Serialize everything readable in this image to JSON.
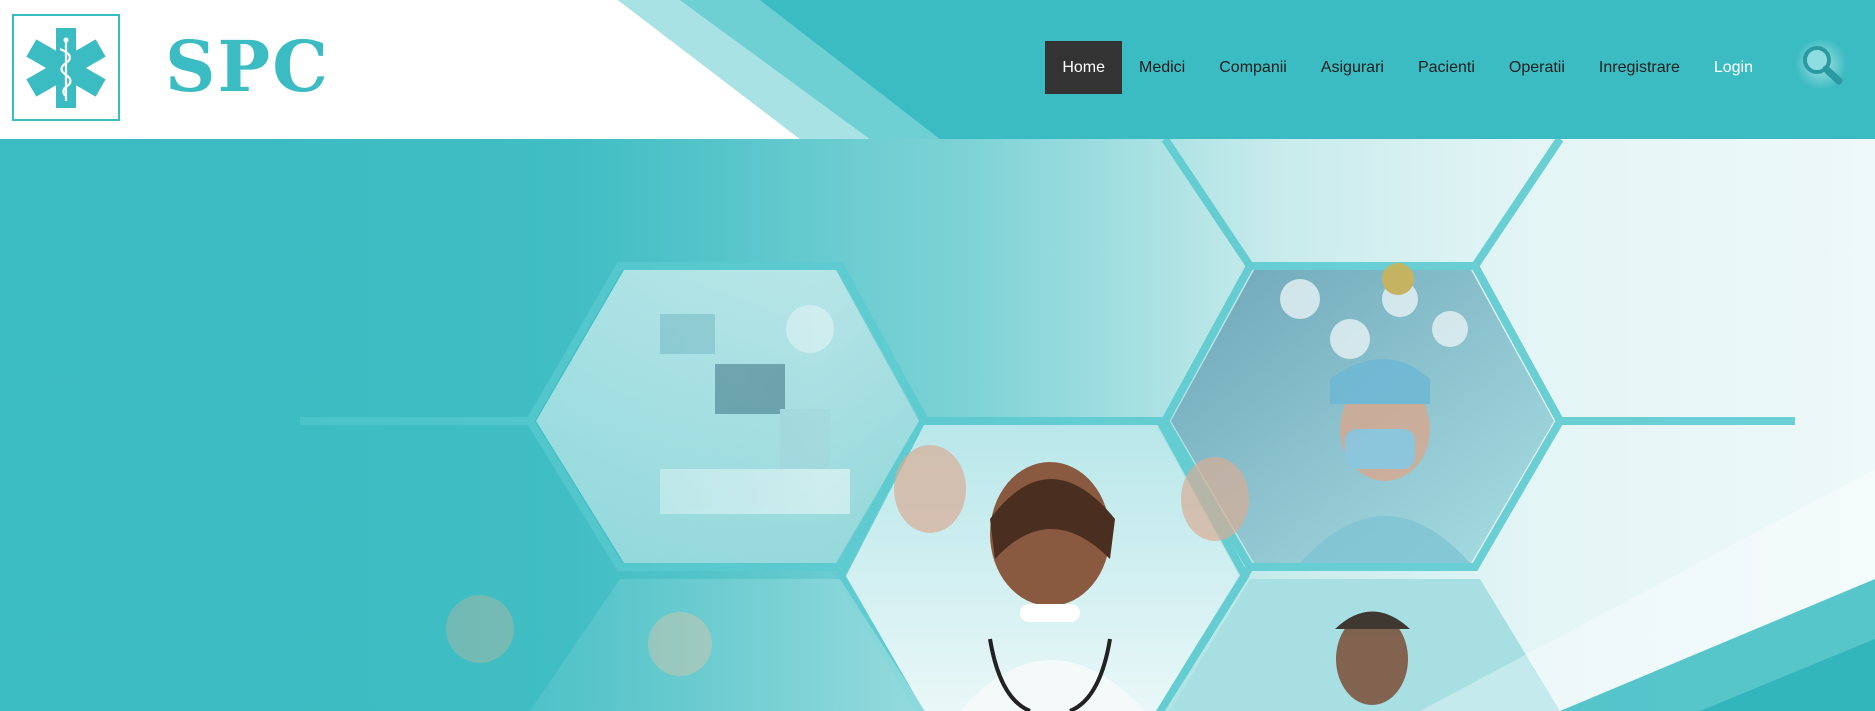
{
  "brand": {
    "name": "SPC",
    "logo_icon": "star-of-life-icon"
  },
  "nav": {
    "items": [
      "Home",
      "Medici",
      "Companii",
      "Asigurari",
      "Pacienti",
      "Operatii",
      "Inregistrare",
      "Login"
    ],
    "active": "Home"
  },
  "search": {
    "icon": "search-icon"
  },
  "colors": {
    "primary": "#3bbcc2",
    "nav_active_bg": "#333333",
    "white": "#ffffff"
  },
  "hero": {
    "image_description_icon": "medical-staff-hexagon-collage"
  }
}
